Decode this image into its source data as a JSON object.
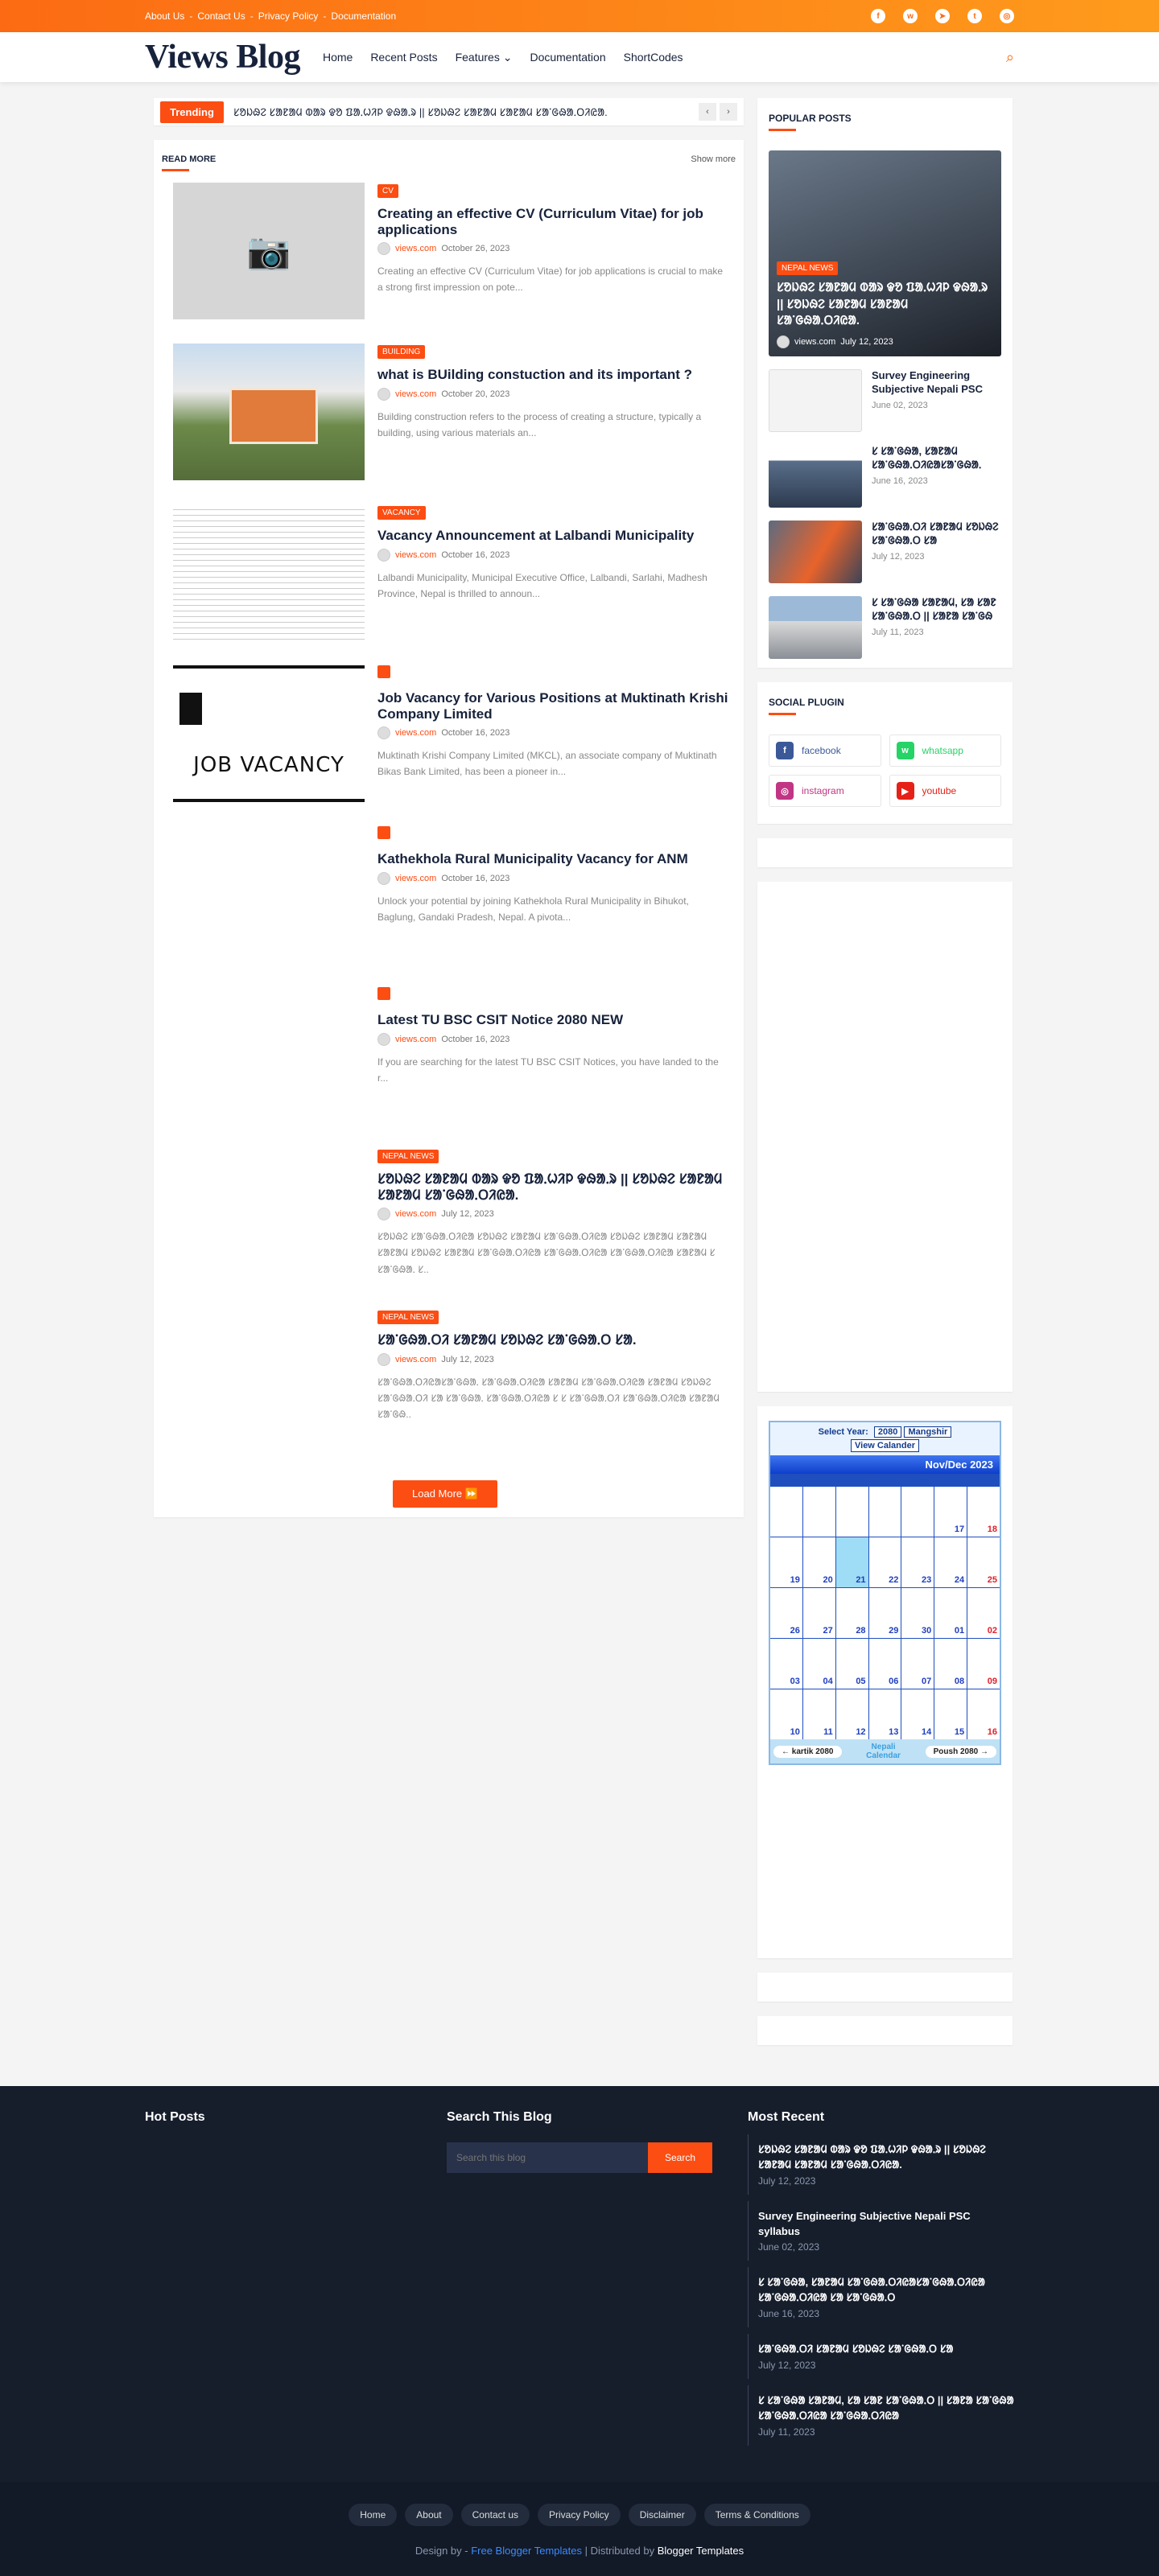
{
  "topbar": {
    "links": [
      "About Us",
      "Contact Us",
      "Privacy Policy",
      "Documentation"
    ],
    "socials": [
      "facebook-icon",
      "whatsapp-icon",
      "telegram-icon",
      "twitter-icon",
      "instagram-icon"
    ]
  },
  "header": {
    "logo": "Views Blog",
    "nav": [
      "Home",
      "Recent Posts",
      "Features",
      "Documentation",
      "ShortCodes"
    ]
  },
  "trending": {
    "label": "Trending",
    "text": "ᱥᱚᱡᱷᱮ ᱥᱟᱱᱟᱢ ᱵᱟᱨ ᱫᱚ ᱯᱟᱹᱦᱤᱞ ᱫᱷᱟᱹᱨ || ᱥᱚᱡᱷᱮ ᱥᱟᱱᱟᱢ ᱥᱟᱱᱟᱢ ᱥᱟᱸᱜᱷᱟᱹᱛᱤᱭᱟ."
  },
  "readmore": {
    "title": "READ MORE",
    "show_more": "Show more",
    "load_more": "Load More ⏩"
  },
  "posts": [
    {
      "tag": "CV",
      "title": "Creating an effective CV (Curriculum Vitae) for job applications",
      "author": "views.com",
      "date": "October 26, 2023",
      "excerpt": "Creating an effective CV (Curriculum Vitae) for job applications is crucial to make a strong first impression on pote..."
    },
    {
      "tag": "BUILDING",
      "title": "what is BUilding constuction and its important ?",
      "author": "views.com",
      "date": "October 20, 2023",
      "excerpt": "Building construction refers to the process of creating a structure, typically a building, using various materials an..."
    },
    {
      "tag": "VACANCY",
      "title": "Vacancy Announcement at Lalbandi Municipality",
      "author": "views.com",
      "date": "October 16, 2023",
      "excerpt": "Lalbandi Municipality, Municipal Executive Office, Lalbandi, Sarlahi, Madhesh Province, Nepal is thrilled to announ..."
    },
    {
      "tag": "",
      "title": "Job Vacancy for Various Positions at Muktinath Krishi Company Limited",
      "author": "views.com",
      "date": "October 16, 2023",
      "excerpt": "Muktinath Krishi Company Limited (MKCL), an associate company of Muktinath Bikas Bank Limited, has been a pioneer in..."
    },
    {
      "tag": "",
      "title": "Kathekhola Rural Municipality Vacancy for ANM",
      "author": "views.com",
      "date": "October 16, 2023",
      "excerpt": "Unlock your potential by joining Kathekhola Rural Municipality in Bihukot, Baglung, Gandaki Pradesh, Nepal. A pivota..."
    },
    {
      "tag": "",
      "title": "Latest TU BSC CSIT Notice 2080 NEW",
      "author": "views.com",
      "date": "October 16, 2023",
      "excerpt": "If you are searching for the latest TU BSC CSIT Notices, you have landed to the r..."
    },
    {
      "tag": "NEPAL NEWS",
      "title": "ᱥᱚᱡᱷᱮ ᱥᱟᱱᱟᱢ ᱵᱟᱨ ᱫᱚ ᱯᱟᱹᱦᱤᱞ ᱫᱷᱟᱹᱨ || ᱥᱚᱡᱷᱮ ᱥᱟᱱᱟᱢ ᱥᱟᱱᱟᱢ ᱥᱟᱸᱜᱷᱟᱹᱛᱤᱭᱟ.",
      "author": "views.com",
      "date": "July 12, 2023",
      "excerpt": "ᱥᱚᱡᱷᱮ ᱥᱟᱸᱜᱷᱟᱹᱛᱤᱭᱟ ᱥᱚᱡᱷᱮ ᱥᱟᱱᱟᱢ ᱥᱟᱸᱜᱷᱟᱹᱛᱤᱭᱟ ᱥᱚᱡᱷᱮ ᱥᱟᱱᱟᱢ ᱥᱟᱱᱟᱢ ᱥᱟᱱᱟᱢ ᱥᱚᱡᱷᱮ ᱥᱟᱱᱟᱢ ᱥᱟᱸᱜᱷᱟᱹᱛᱤᱭᱟ ᱥᱟᱸᱜᱷᱟᱹᱛᱤᱭᱟ ᱥᱟᱸᱜᱷᱟᱹᱛᱤᱭᱟ ᱥᱟᱱᱟᱢ ᱥ ᱥᱟᱸᱜᱷᱟᱹ ᱥ.."
    },
    {
      "tag": "NEPAL NEWS",
      "title": "ᱥᱟᱸᱜᱷᱟᱹᱛᱤ ᱥᱟᱱᱟᱢ ᱥᱚᱡᱷᱮ ᱥᱟᱸᱜᱷᱟᱹᱛ ᱥᱟ.",
      "author": "views.com",
      "date": "July 12, 2023",
      "excerpt": "ᱥᱟᱸᱜᱷᱟᱹᱛᱤᱭᱟᱥᱟᱸᱜᱷᱟᱹ ᱥᱟᱸᱜᱷᱟᱹᱛᱤᱭᱟ ᱥᱟᱱᱟᱢ ᱥᱟᱸᱜᱷᱟᱹᱛᱤᱭᱟ ᱥᱟᱱᱟᱢ ᱥᱚᱡᱷᱮ ᱥᱟᱸᱜᱷᱟᱹᱛᱤ ᱥᱟ ᱥᱟᱸᱜᱷᱟᱹ ᱥᱟᱸᱜᱷᱟᱹᱛᱤᱭᱟ ᱥ ᱥ ᱥᱟᱸᱜᱷᱟᱹᱛᱤ ᱥᱟᱸᱜᱷᱟᱹᱛᱤᱭᱟ ᱥᱟᱱᱟᱢ ᱥᱟᱸᱜᱷ.."
    }
  ],
  "popular": {
    "title": "POPULAR POSTS",
    "big": {
      "tag": "NEPAL NEWS",
      "title": "ᱥᱚᱡᱷᱮ ᱥᱟᱱᱟᱢ ᱵᱟᱨ ᱫᱚ ᱯᱟᱹᱦᱤᱞ ᱫᱷᱟᱹᱨ || ᱥᱚᱡᱷᱮ ᱥᱟᱱᱟᱢ ᱥᱟᱱᱟᱢ ᱥᱟᱸᱜᱷᱟᱹᱛᱤᱭᱟ.",
      "author": "views.com",
      "date": "July 12, 2023"
    },
    "items": [
      {
        "title": "Survey Engineering Subjective Nepali PSC",
        "date": "June 02, 2023"
      },
      {
        "title": "ᱥ ᱥᱟᱸᱜᱷᱟ, ᱥᱟᱱᱟᱢ ᱥᱟᱸᱜᱷᱟᱹᱛᱤᱭᱟᱥᱟᱸᱜᱷᱟᱹ",
        "date": "June 16, 2023"
      },
      {
        "title": "ᱥᱟᱸᱜᱷᱟᱹᱛᱤ ᱥᱟᱱᱟᱢ ᱥᱚᱡᱷᱮ ᱥᱟᱸᱜᱷᱟᱹᱛ ᱥᱟ",
        "date": "July 12, 2023"
      },
      {
        "title": "ᱥ ᱥᱟᱸᱜᱷᱟ ᱥᱟᱱᱟᱢ, ᱥᱟ ᱥᱟᱱ ᱥᱟᱸᱜᱷᱟᱹᱛ || ᱥᱟᱱᱟ ᱥᱟᱸᱜᱷ",
        "date": "July 11, 2023"
      }
    ]
  },
  "social": {
    "title": "SOCIAL PLUGIN",
    "items": [
      {
        "label": "facebook",
        "color": "#3b5998"
      },
      {
        "label": "whatsapp",
        "color": "#25d366"
      },
      {
        "label": "instagram",
        "color": "#c13584"
      },
      {
        "label": "youtube",
        "color": "#e62117"
      }
    ]
  },
  "calendar": {
    "select_year": "Select Year:",
    "year": "2080",
    "month": "Mangshir",
    "view_btn": "View Calander",
    "header": "Nov/Dec 2023",
    "days": [
      "",
      "",
      "",
      "",
      "",
      "17",
      "18",
      "19",
      "20",
      "21",
      "22",
      "23",
      "24",
      "25",
      "26",
      "27",
      "28",
      "29",
      "30",
      "01",
      "02",
      "03",
      "04",
      "05",
      "06",
      "07",
      "08",
      "09",
      "10",
      "11",
      "12",
      "13",
      "14",
      "15",
      "16"
    ],
    "prev": "← kartik 2080",
    "center": "Nepali Calendar",
    "next": "Poush 2080 →"
  },
  "footer": {
    "hot": "Hot Posts",
    "search": "Search This Blog",
    "search_placeholder": "Search this blog",
    "search_btn": "Search",
    "recent": "Most Recent",
    "recent_items": [
      {
        "title": "ᱥᱚᱡᱷᱮ ᱥᱟᱱᱟᱢ ᱵᱟᱨ ᱫᱚ ᱯᱟᱹᱦᱤᱞ ᱫᱷᱟᱹᱨ || ᱥᱚᱡᱷᱮ ᱥᱟᱱᱟᱢ ᱥᱟᱱᱟᱢ ᱥᱟᱸᱜᱷᱟᱹᱛᱤᱭᱟ.",
        "date": "July 12, 2023"
      },
      {
        "title": "Survey Engineering Subjective Nepali PSC syllabus",
        "date": "June 02, 2023"
      },
      {
        "title": "ᱥ ᱥᱟᱸᱜᱷᱟ, ᱥᱟᱱᱟᱢ ᱥᱟᱸᱜᱷᱟᱹᱛᱤᱭᱟᱥᱟᱸᱜᱷᱟᱹᱛᱤᱭᱟ ᱥᱟᱸᱜᱷᱟᱹᱛᱤᱭᱟ ᱥᱟ ᱥᱟᱸᱜᱷᱟᱹᱛ",
        "date": "June 16, 2023"
      },
      {
        "title": "ᱥᱟᱸᱜᱷᱟᱹᱛᱤ ᱥᱟᱱᱟᱢ ᱥᱚᱡᱷᱮ ᱥᱟᱸᱜᱷᱟᱹᱛ ᱥᱟ",
        "date": "July 12, 2023"
      },
      {
        "title": "ᱥ ᱥᱟᱸᱜᱷᱟ ᱥᱟᱱᱟᱢ, ᱥᱟ ᱥᱟᱱ ᱥᱟᱸᱜᱷᱟᱹᱛ || ᱥᱟᱱᱟ ᱥᱟᱸᱜᱷᱟ ᱥᱟᱸᱜᱷᱟᱹᱛᱤᱭᱟ ᱥᱟᱸᱜᱷᱟᱹᱛᱤᱭᱟ",
        "date": "July 11, 2023"
      }
    ]
  },
  "bottom": {
    "links": [
      "Home",
      "About",
      "Contact us",
      "Privacy Policy",
      "Disclaimer",
      "Terms & Conditions"
    ],
    "design_by": "Design by - ",
    "ftemplates": "Free Blogger Templates",
    "distributed": " | Distributed by ",
    "btemplates": "Blogger Templates"
  }
}
